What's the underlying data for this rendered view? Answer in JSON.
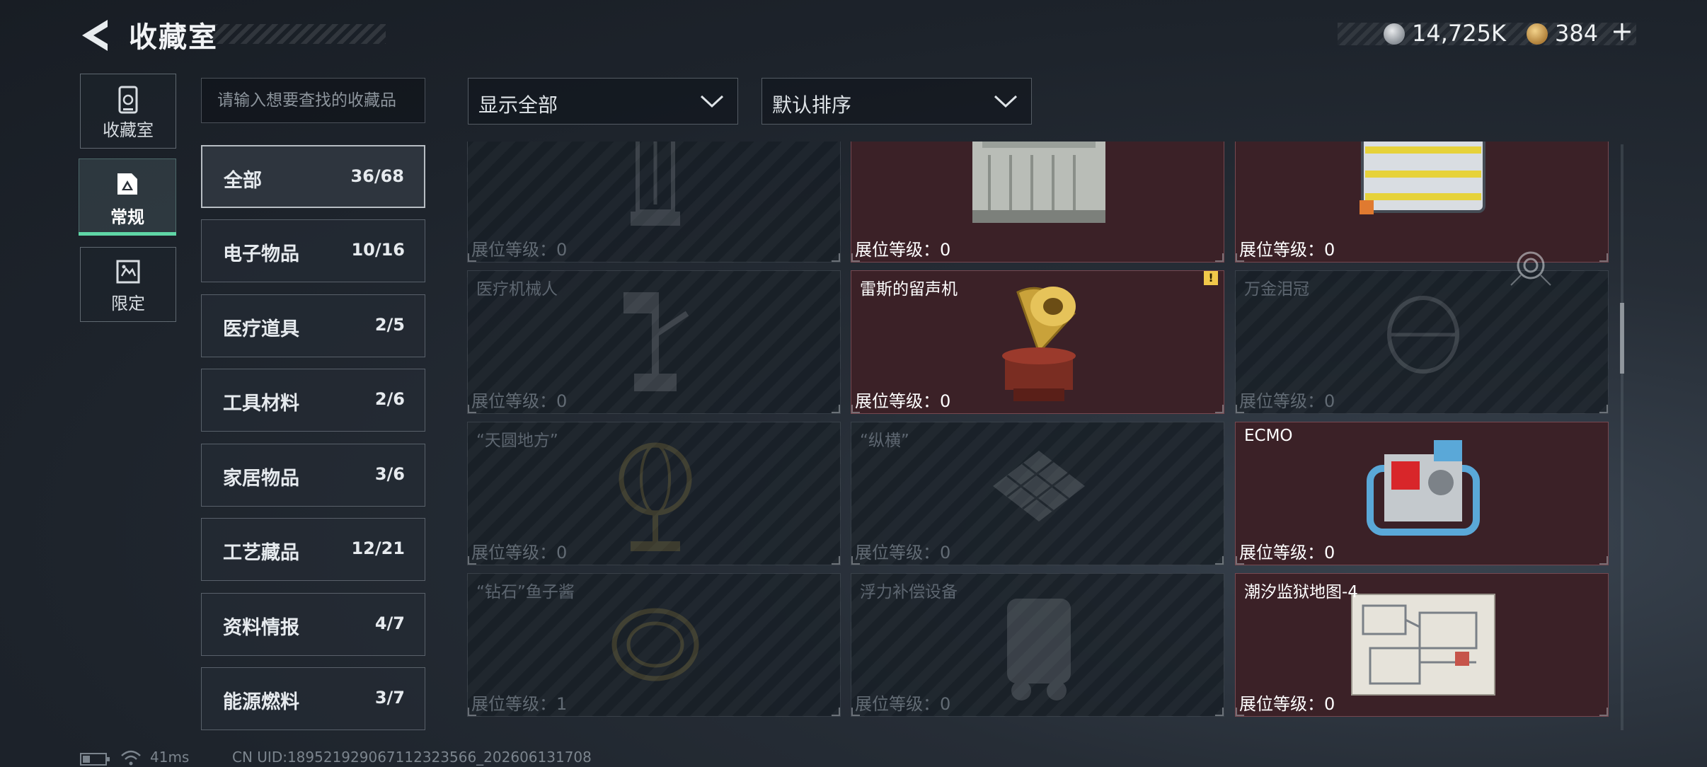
{
  "header": {
    "title": "收藏室",
    "currencies": [
      {
        "icon": "silver-coin-icon",
        "value": "14,725K"
      },
      {
        "icon": "gold-coin-icon",
        "value": "384"
      }
    ],
    "add_label": "+"
  },
  "modes": [
    {
      "label": "收藏室",
      "icon": "cabinet-icon",
      "selected": false
    },
    {
      "label": "常规",
      "icon": "regular-collection-icon",
      "selected": true
    },
    {
      "label": "限定",
      "icon": "limited-collection-icon",
      "selected": false
    }
  ],
  "search": {
    "placeholder": "请输入想要查找的收藏品",
    "value": ""
  },
  "categories": [
    {
      "name": "全部",
      "count": "36/68",
      "active": true
    },
    {
      "name": "电子物品",
      "count": "10/16",
      "active": false
    },
    {
      "name": "医疗道具",
      "count": "2/5",
      "active": false
    },
    {
      "name": "工具材料",
      "count": "2/6",
      "active": false
    },
    {
      "name": "家居物品",
      "count": "3/6",
      "active": false
    },
    {
      "name": "工艺藏品",
      "count": "12/21",
      "active": false
    },
    {
      "name": "资料情报",
      "count": "4/7",
      "active": false
    },
    {
      "name": "能源燃料",
      "count": "3/7",
      "active": false
    }
  ],
  "filters": {
    "display": {
      "selected": "显示全部"
    },
    "sort": {
      "selected": "默认排序"
    }
  },
  "level_prefix": "展位等级：",
  "grid": {
    "items": [
      {
        "name": "",
        "level": "0",
        "owned": false,
        "illus": "tower"
      },
      {
        "name": "",
        "level": "0",
        "owned": true,
        "illus": "battery"
      },
      {
        "name": "",
        "level": "0",
        "owned": true,
        "illus": "cell-pack"
      },
      {
        "name": "医疗机械人",
        "level": "0",
        "owned": false,
        "illus": "robot"
      },
      {
        "name": "雷斯的留声机",
        "level": "0",
        "owned": true,
        "illus": "gramophone",
        "alert": "!"
      },
      {
        "name": "万金泪冠",
        "level": "0",
        "owned": false,
        "illus": "crown"
      },
      {
        "name": "“天圆地方”",
        "level": "0",
        "owned": false,
        "illus": "globe"
      },
      {
        "name": "“纵横”",
        "level": "0",
        "owned": false,
        "illus": "chessboard"
      },
      {
        "name": "ECMO",
        "level": "0",
        "owned": true,
        "illus": "ecmo"
      },
      {
        "name": "“钻石”鱼子酱",
        "level": "1",
        "owned": false,
        "illus": "tin"
      },
      {
        "name": "浮力补偿设备",
        "level": "0",
        "owned": false,
        "illus": "vest"
      },
      {
        "name": "潮汐监狱地图-4",
        "level": "0",
        "owned": true,
        "illus": "map"
      }
    ]
  },
  "status": {
    "ping": "41ms",
    "uid": "CN UID:189521929067112323566_202606131708"
  },
  "colors": {
    "accent": "#5fd6a6",
    "owned_bg": "#3b2127",
    "alert": "#f1c84a"
  }
}
